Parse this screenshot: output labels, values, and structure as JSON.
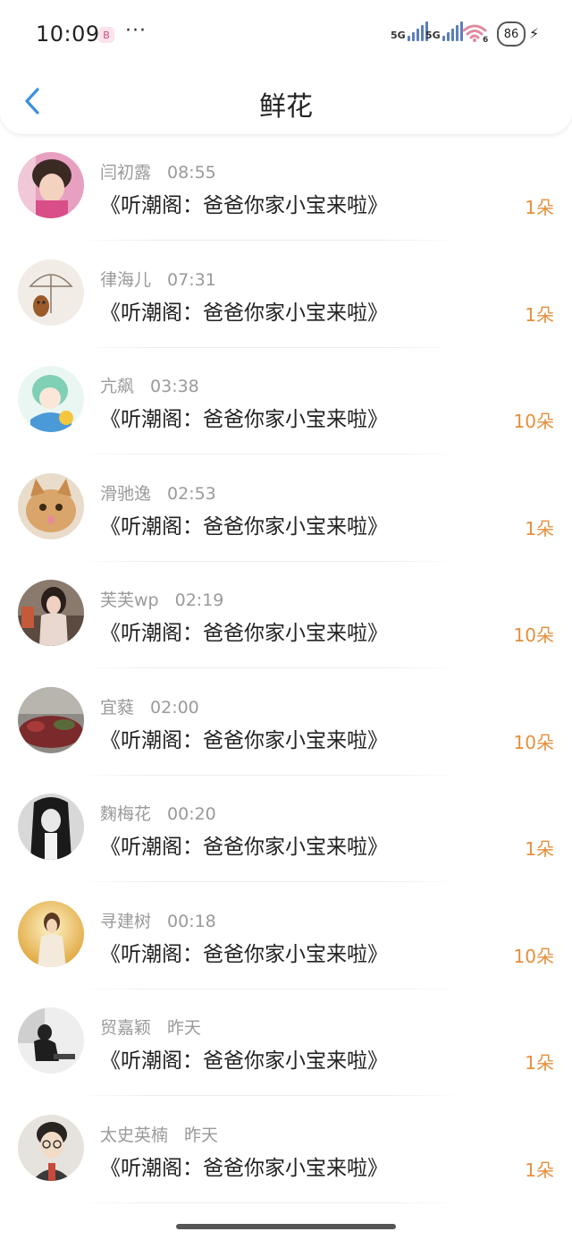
{
  "status": {
    "time": "10:09",
    "app_badge": "B",
    "more": "···",
    "net1": "5G",
    "net2": "5G",
    "wifi_suffix": "6",
    "battery": "86",
    "charging": "⚡"
  },
  "header": {
    "title": "鲜花",
    "back_icon": "chevron-left-icon"
  },
  "colors": {
    "count": "#e58f3c",
    "back": "#3b8fe0"
  },
  "items": [
    {
      "name": "闫初露",
      "time": "08:55",
      "message": "《听潮阁：爸爸你家小宝来啦》",
      "count": "1朵"
    },
    {
      "name": "律海儿",
      "time": "07:31",
      "message": "《听潮阁：爸爸你家小宝来啦》",
      "count": "1朵"
    },
    {
      "name": "亢飙",
      "time": "03:38",
      "message": "《听潮阁：爸爸你家小宝来啦》",
      "count": "10朵"
    },
    {
      "name": "滑驰逸",
      "time": "02:53",
      "message": "《听潮阁：爸爸你家小宝来啦》",
      "count": "1朵"
    },
    {
      "name": "芙芙wp",
      "time": "02:19",
      "message": "《听潮阁：爸爸你家小宝来啦》",
      "count": "10朵"
    },
    {
      "name": "宜蕤",
      "time": "02:00",
      "message": "《听潮阁：爸爸你家小宝来啦》",
      "count": "10朵"
    },
    {
      "name": "麴梅花",
      "time": "00:20",
      "message": "《听潮阁：爸爸你家小宝来啦》",
      "count": "1朵"
    },
    {
      "name": "寻建树",
      "time": "00:18",
      "message": "《听潮阁：爸爸你家小宝来啦》",
      "count": "10朵"
    },
    {
      "name": "贸嘉颖",
      "time": "昨天",
      "message": "《听潮阁：爸爸你家小宝来啦》",
      "count": "1朵"
    },
    {
      "name": "太史英楠",
      "time": "昨天",
      "message": "《听潮阁：爸爸你家小宝来啦》",
      "count": "1朵"
    }
  ]
}
